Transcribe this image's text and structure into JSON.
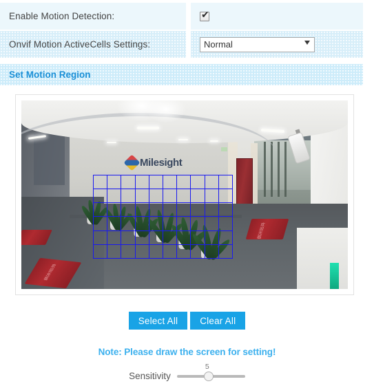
{
  "settings": {
    "rows": [
      {
        "label": "Enable Motion Detection:",
        "control": "checkbox",
        "checked": true
      },
      {
        "label": "Onvif Motion ActiveCells Settings:",
        "control": "select",
        "value": "Normal"
      }
    ]
  },
  "section": {
    "title": "Set Motion Region"
  },
  "video": {
    "wall_logo_text": "Milesight",
    "grid": {
      "columns": 10,
      "rows": 6
    },
    "mat_text_left": "欢迎光临",
    "mat_text_right": "欢迎光临"
  },
  "actions": {
    "select_all_label": "Select All",
    "clear_all_label": "Clear All"
  },
  "note": {
    "text": "Note: Please draw the screen for setting!"
  },
  "sensitivity": {
    "label": "Sensitivity",
    "value": "5",
    "min": "0",
    "max": "10"
  },
  "colors": {
    "accent": "#19a3e6",
    "header_text": "#1a8fd6",
    "note_text": "#3bb0ee",
    "grid_line": "#1919f0",
    "row_light": "#ecf7fc",
    "row_dotted": "#d7eef9",
    "section_bg": "#cdecfa"
  }
}
